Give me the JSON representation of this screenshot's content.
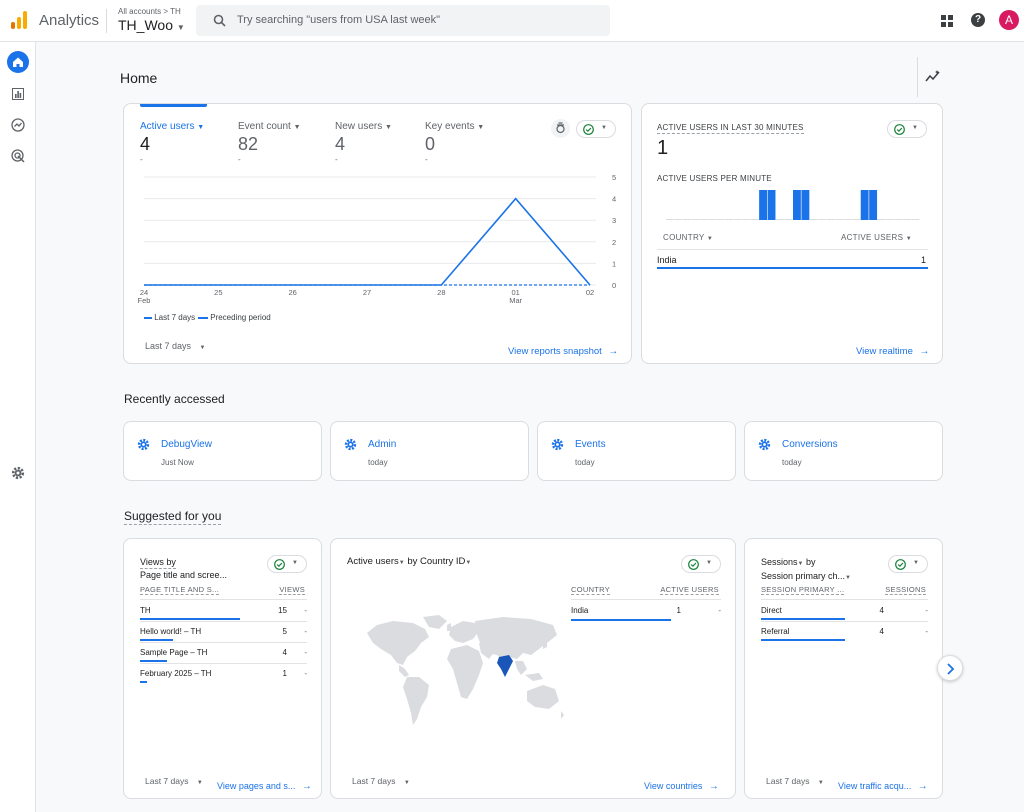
{
  "app": {
    "name": "Analytics",
    "breadcrumb": "All accounts > TH",
    "account": "TH_Woo",
    "search_placeholder": "Try searching \"users from USA last week\"",
    "avatar": "A"
  },
  "page": {
    "title": "Home"
  },
  "overview": {
    "metrics": [
      {
        "label": "Active users",
        "value": "4",
        "sub": "-"
      },
      {
        "label": "Event count",
        "value": "82",
        "sub": "-"
      },
      {
        "label": "New users",
        "value": "4",
        "sub": "-"
      },
      {
        "label": "Key events",
        "value": "0",
        "sub": "-"
      }
    ],
    "legend": {
      "current": "Last 7 days",
      "previous": "Preceding period"
    },
    "date_range": "Last 7 days",
    "link": "View reports snapshot"
  },
  "chart_data": {
    "type": "line",
    "x": [
      "24 Feb",
      "25",
      "26",
      "27",
      "28",
      "01 Mar",
      "02"
    ],
    "x_ticks": [
      {
        "top": "24",
        "bottom": "Feb"
      },
      {
        "top": "25",
        "bottom": ""
      },
      {
        "top": "26",
        "bottom": ""
      },
      {
        "top": "27",
        "bottom": ""
      },
      {
        "top": "28",
        "bottom": ""
      },
      {
        "top": "01",
        "bottom": "Mar"
      },
      {
        "top": "02",
        "bottom": ""
      }
    ],
    "series": [
      {
        "name": "Last 7 days",
        "values": [
          0,
          0,
          0,
          0,
          0,
          4,
          0
        ]
      },
      {
        "name": "Preceding period",
        "values": [
          0,
          0,
          0,
          0,
          0,
          0,
          0
        ]
      }
    ],
    "y_ticks": [
      "5",
      "4",
      "3",
      "2",
      "1",
      "0"
    ],
    "ylim": [
      0,
      5
    ]
  },
  "realtime": {
    "title": "ACTIVE USERS IN LAST 30 MINUTES",
    "value": "1",
    "per_minute_label": "ACTIVE USERS PER MINUTE",
    "per_minute_bars": [
      0,
      0,
      0,
      0,
      0,
      0,
      0,
      0,
      0,
      0,
      0,
      1,
      1,
      0,
      0,
      1,
      1,
      0,
      0,
      0,
      0,
      0,
      0,
      1,
      1,
      0,
      0,
      0,
      0,
      0
    ],
    "col_country": "COUNTRY",
    "col_users": "ACTIVE USERS",
    "rows": [
      {
        "country": "India",
        "value": "1"
      }
    ],
    "link": "View realtime"
  },
  "recent": {
    "title": "Recently accessed",
    "items": [
      {
        "name": "DebugView",
        "when": "Just Now"
      },
      {
        "name": "Admin",
        "when": "today"
      },
      {
        "name": "Events",
        "when": "today"
      },
      {
        "name": "Conversions",
        "when": "today"
      }
    ]
  },
  "suggested": {
    "title": "Suggested for you",
    "pages": {
      "title_line1": "Views by",
      "title_line2": "Page title and scree...",
      "col1": "PAGE TITLE AND S...",
      "col2": "VIEWS",
      "rows": [
        {
          "name": "TH",
          "value": "15",
          "change": "-",
          "bar": 1.0
        },
        {
          "name": "Hello world! – TH",
          "value": "5",
          "change": "-",
          "bar": 0.33
        },
        {
          "name": "Sample Page – TH",
          "value": "4",
          "change": "-",
          "bar": 0.27
        },
        {
          "name": "February 2025 – TH",
          "value": "1",
          "change": "-",
          "bar": 0.07
        }
      ],
      "date_range": "Last 7 days",
      "link": "View pages and s..."
    },
    "countries": {
      "title_a": "Active users",
      "title_b": "by Country ID",
      "col1": "COUNTRY",
      "col2": "ACTIVE USERS",
      "rows": [
        {
          "name": "India",
          "value": "1",
          "change": "-",
          "bar": 1.0
        }
      ],
      "date_range": "Last 7 days",
      "link": "View countries"
    },
    "traffic": {
      "title_line1a": "Sessions",
      "title_line1b": "by",
      "title_line2": "Session primary ch...",
      "col1": "SESSION PRIMARY ...",
      "col2": "SESSIONS",
      "rows": [
        {
          "name": "Direct",
          "value": "4",
          "change": "-",
          "bar": 1.0
        },
        {
          "name": "Referral",
          "value": "4",
          "change": "-",
          "bar": 1.0
        }
      ],
      "date_range": "Last 7 days",
      "link": "View traffic acqu..."
    }
  },
  "colors": {
    "accent": "#1a73e8",
    "map_land": "#dadce0",
    "map_highlight": "#1a56b8",
    "logo_orange": "#f9ab00",
    "logo_dark": "#e37400",
    "check": "#188038"
  }
}
